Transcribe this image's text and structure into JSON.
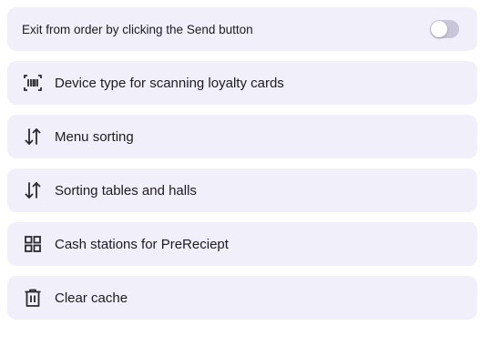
{
  "settings": {
    "toggle": {
      "label": "Exit from order by clicking the Send button",
      "enabled": false
    },
    "items": [
      {
        "label": "Device type for scanning loyalty cards",
        "icon": "barcode-scanner-icon"
      },
      {
        "label": "Menu sorting",
        "icon": "sort-arrows-icon"
      },
      {
        "label": "Sorting tables and halls",
        "icon": "sort-arrows-icon"
      },
      {
        "label": "Cash stations for PreReciept",
        "icon": "grid-icon"
      },
      {
        "label": "Clear cache",
        "icon": "trash-icon"
      }
    ]
  },
  "colors": {
    "card_background": "#f1eff9",
    "text": "#1d1b20",
    "switch_track": "#c9c6dc",
    "switch_knob": "#ffffff"
  }
}
